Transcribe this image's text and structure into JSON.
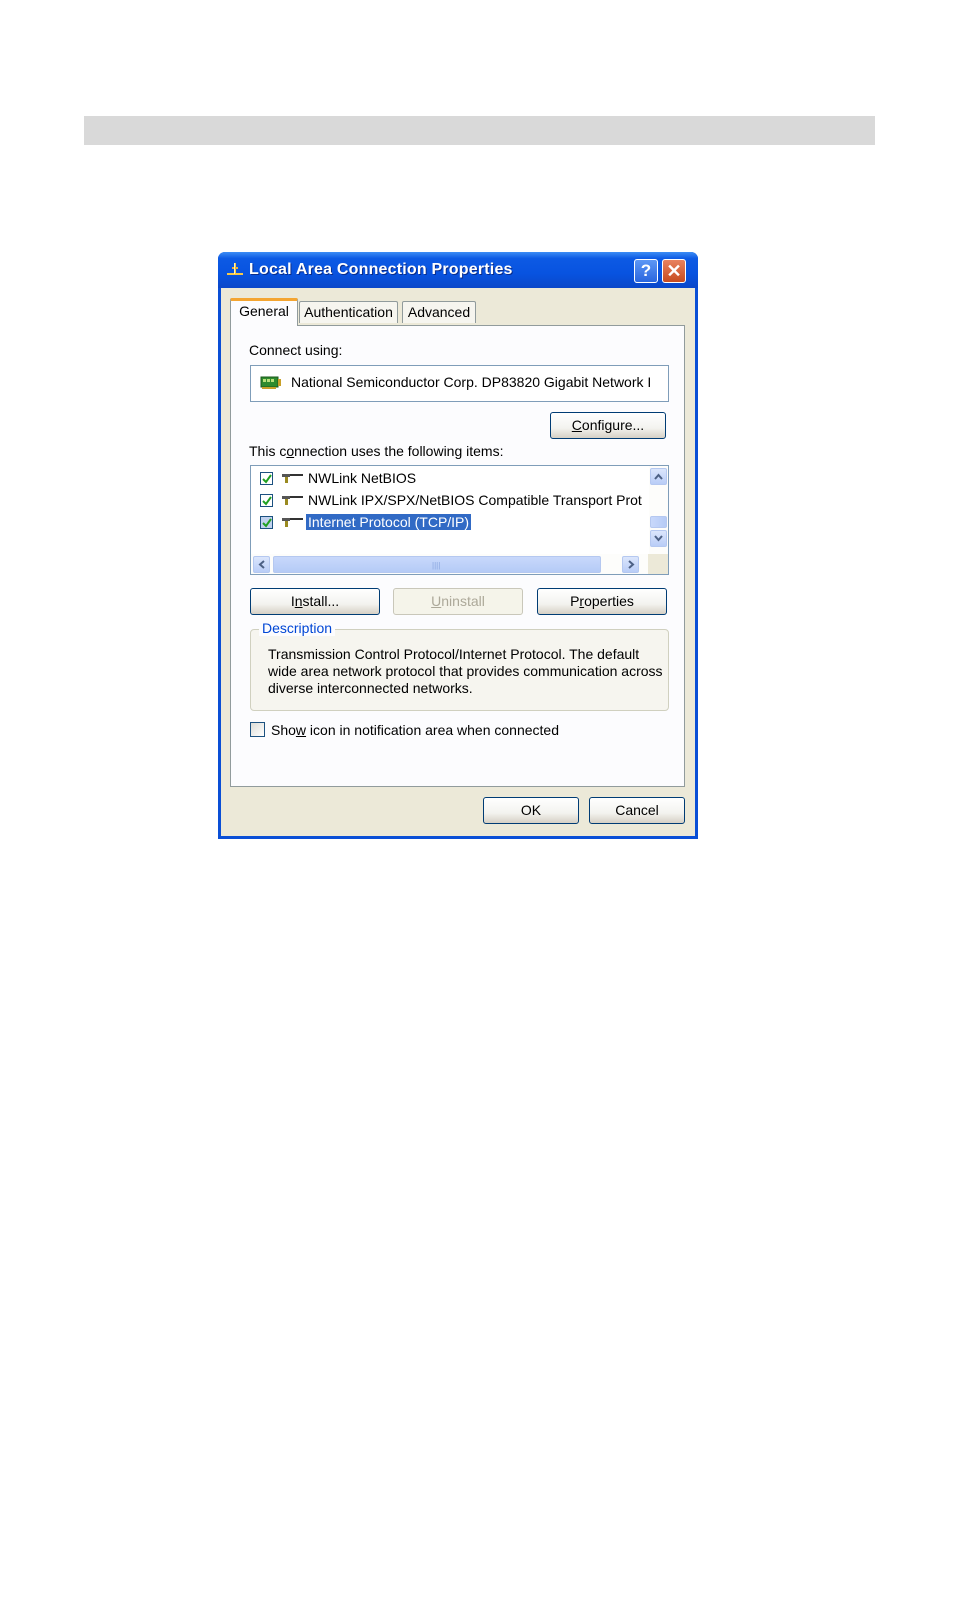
{
  "page": {
    "header_bar_color": "#d9d9d9"
  },
  "dialog": {
    "title": "Local Area Connection Properties",
    "title_icon": "network-connection-icon",
    "help_label": "?",
    "close_label": "✕",
    "tabs": [
      {
        "label": "General",
        "active": true
      },
      {
        "label": "Authentication",
        "active": false
      },
      {
        "label": "Advanced",
        "active": false
      }
    ],
    "connect_using_label_pre": "Connect using:",
    "adapter_icon": "network-adapter-icon",
    "adapter_name": "National Semiconductor Corp. DP83820 Gigabit Network I",
    "configure_button": {
      "pre": "",
      "accel": "C",
      "post": "onfigure..."
    },
    "items_label": {
      "pre": "This c",
      "accel": "o",
      "post": "nnection uses the following items:"
    },
    "items": [
      {
        "label": "NWLink NetBIOS",
        "checked": true,
        "selected": false,
        "icon": "protocol-icon"
      },
      {
        "label": "NWLink IPX/SPX/NetBIOS Compatible Transport Prot",
        "checked": true,
        "selected": false,
        "icon": "protocol-icon"
      },
      {
        "label": "Internet Protocol (TCP/IP)",
        "checked": true,
        "selected": true,
        "icon": "protocol-icon"
      }
    ],
    "install_button": {
      "pre": "I",
      "accel": "n",
      "post": "stall..."
    },
    "uninstall_button": {
      "pre": "",
      "accel": "U",
      "post": "ninstall",
      "disabled": true
    },
    "properties_button": {
      "pre": "P",
      "accel": "r",
      "post": "operties"
    },
    "description": {
      "title": "Description",
      "text": "Transmission Control Protocol/Internet Protocol. The default wide area network protocol that provides communication across diverse interconnected networks."
    },
    "show_icon": {
      "pre": "Sho",
      "accel": "w",
      "post": " icon in notification area when connected",
      "checked": false
    },
    "ok_label": "OK",
    "cancel_label": "Cancel",
    "accent_color": "#0a4fd6",
    "selection_color": "#316ac5"
  }
}
